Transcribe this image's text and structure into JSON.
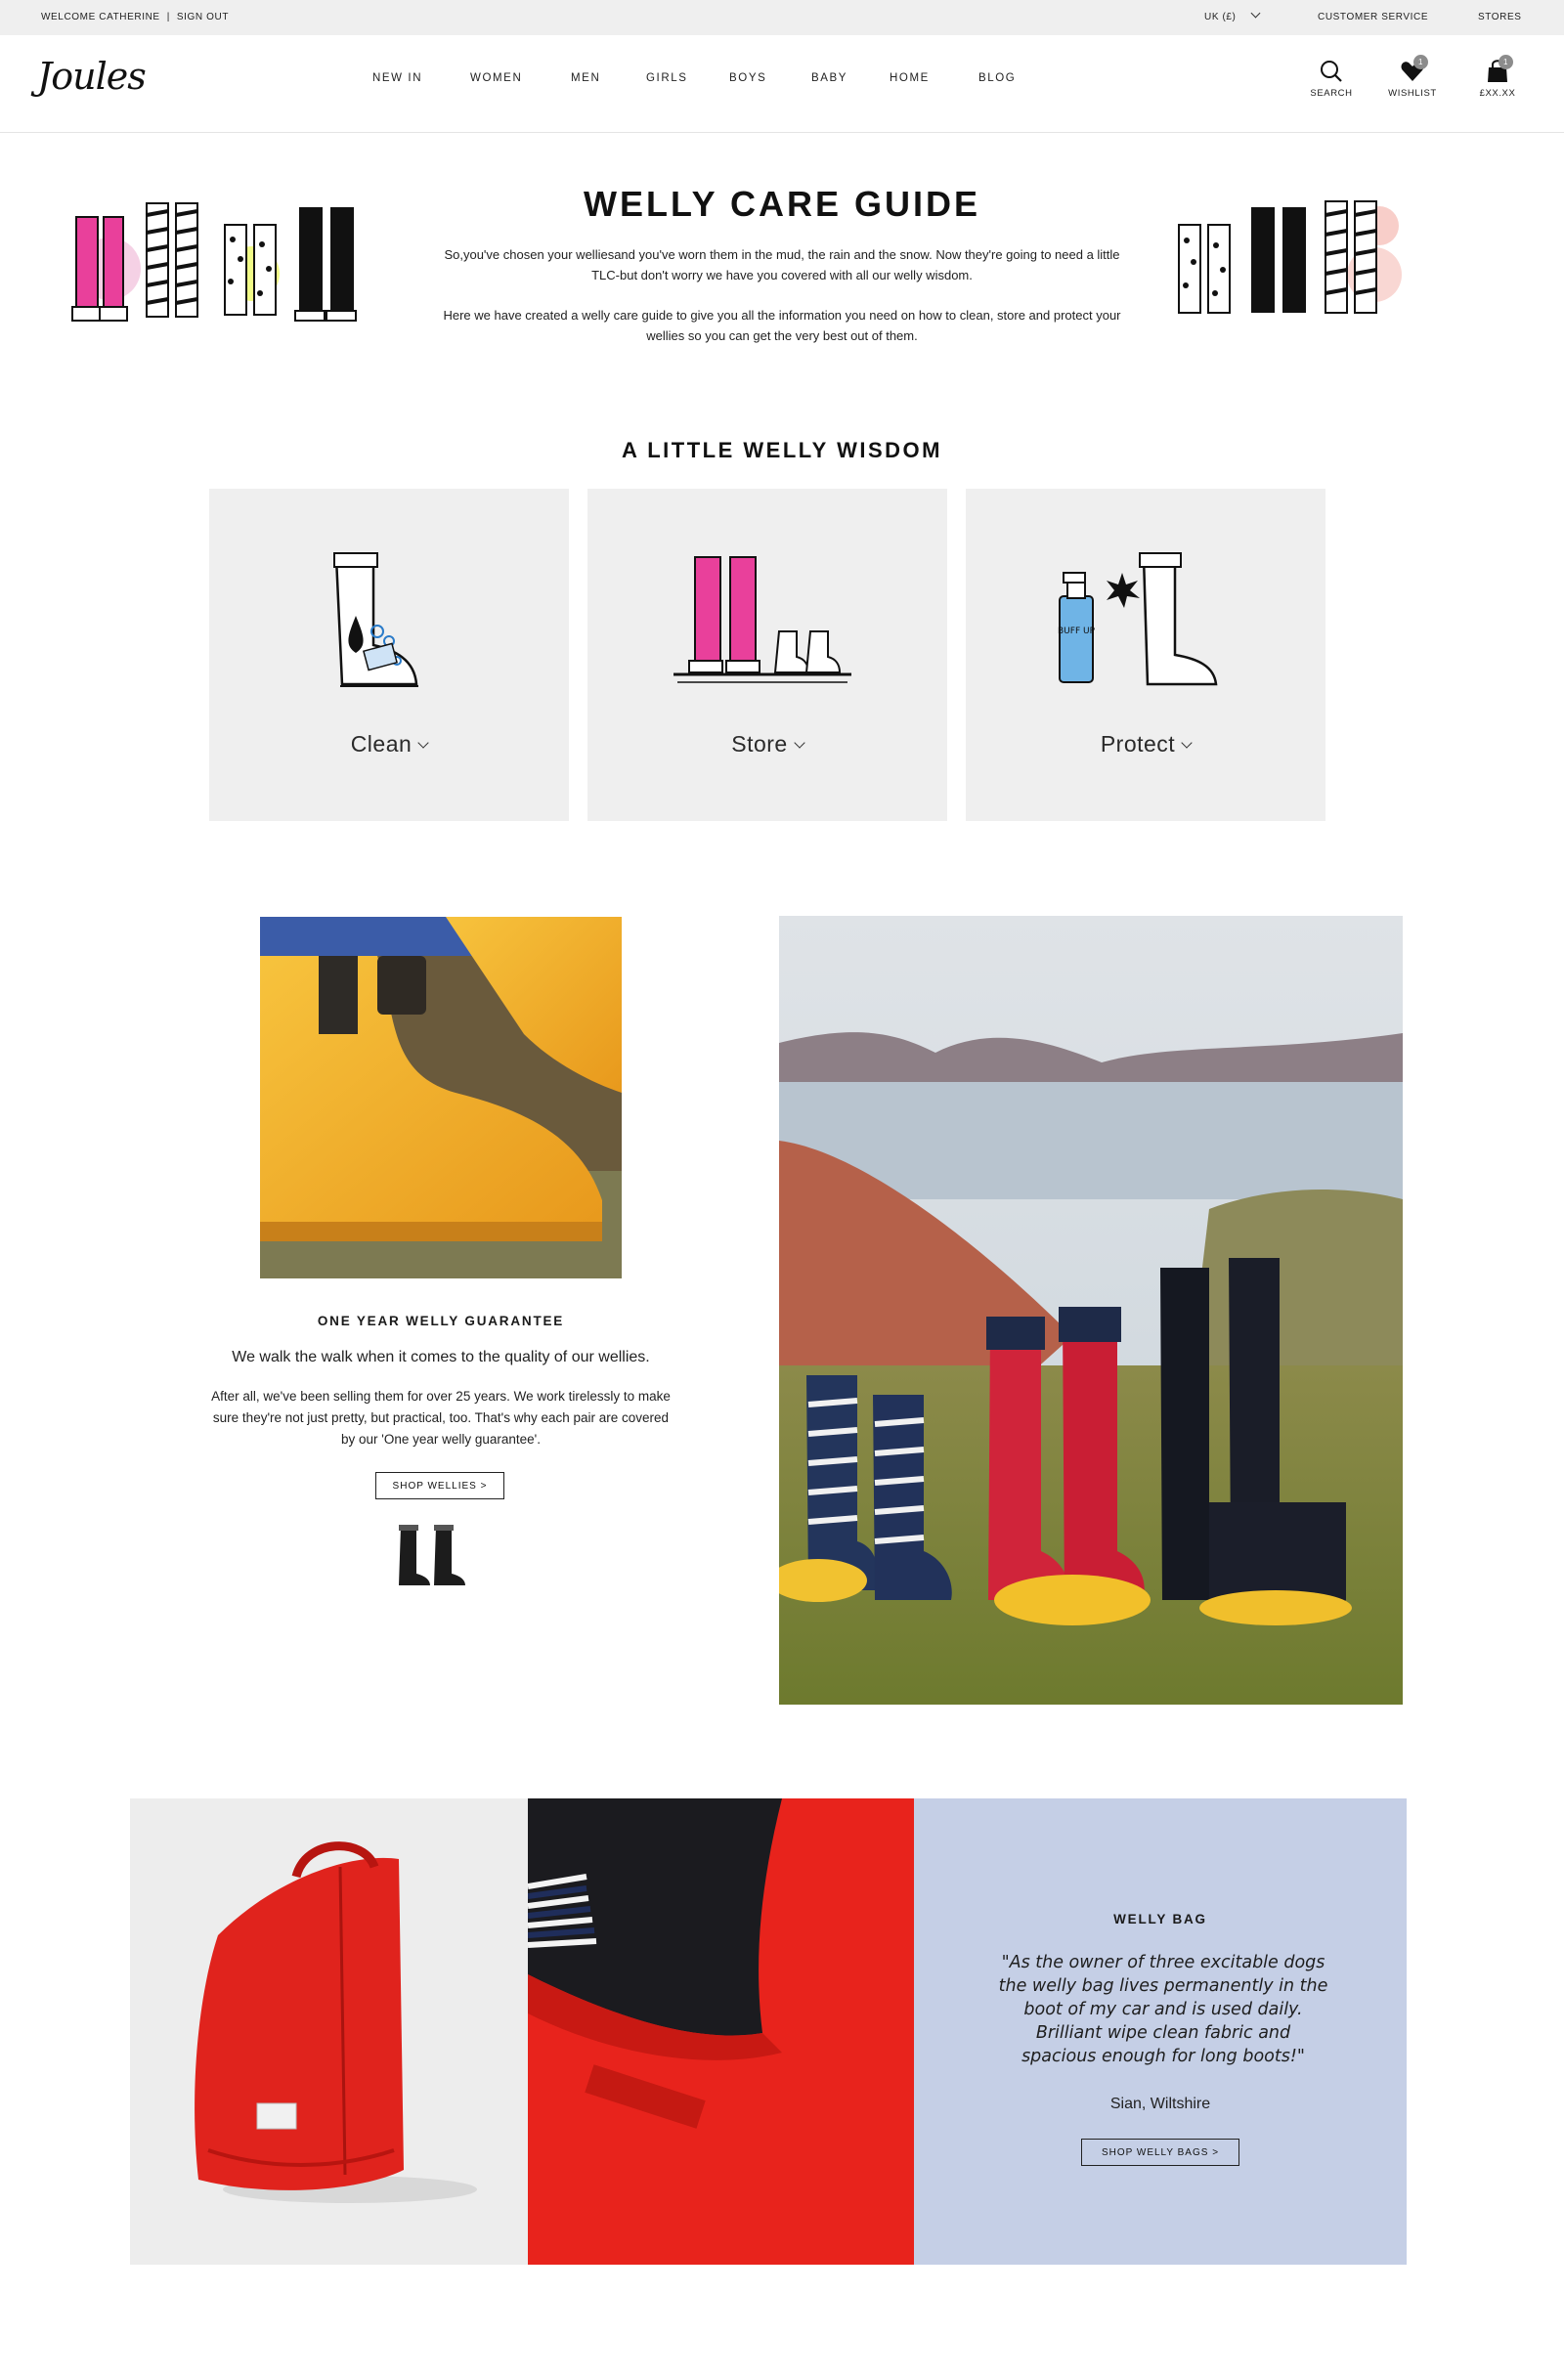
{
  "topbar": {
    "welcome": "WELCOME CATHERINE",
    "divider": "|",
    "sign_out": "SIGN OUT",
    "currency": "UK (£)",
    "customer_service": "CUSTOMER SERVICE",
    "stores": "STORES"
  },
  "header": {
    "logo": "Joules",
    "nav": [
      "NEW IN",
      "WOMEN",
      "MEN",
      "GIRLS",
      "BOYS",
      "BABY",
      "HOME",
      "BLOG"
    ],
    "search_label": "SEARCH",
    "wishlist_label": "WISHLIST",
    "wishlist_count": "1",
    "basket_label": "£XX.XX",
    "basket_count": "1"
  },
  "intro": {
    "title": "WELLY CARE GUIDE",
    "para1": "So,you've chosen your welliesand you've worn them in the mud, the rain and the snow. Now they're going to need a little TLC-but don't worry we have you covered with all our welly wisdom.",
    "para2": "Here we have created a welly care guide to give you all the information you need on how to clean, store and protect your wellies so you can get the very best out of them."
  },
  "wisdom": {
    "title": "A LITTLE WELLY WISDOM",
    "cards": [
      {
        "label": "Clean"
      },
      {
        "label": "Store"
      },
      {
        "label": "Protect"
      }
    ],
    "spray_text": "BUFF UP"
  },
  "guarantee": {
    "title": "ONE YEAR WELLY GUARANTEE",
    "lead": "We walk the walk when it comes to the quality of our wellies.",
    "body": "After all, we've been selling them for over 25 years. We work tirelessly to make sure they're not just pretty, but practical, too. That's why each pair are covered by our 'One year welly guarantee'.",
    "button": "SHOP WELLIES >"
  },
  "welly_bag": {
    "title": "WELLY BAG",
    "quote": "\"As the owner of three excitable dogs the welly bag lives permanently in the boot of my car and is used daily. Brilliant wipe clean fabric and spacious enough for long boots!\"",
    "author": "Sian, Wiltshire",
    "button": "SHOP WELLY BAGS >"
  },
  "colors": {
    "topbar_bg": "#efefef",
    "card_bg": "#efefef",
    "quote_panel_bg": "#c5cfe6",
    "bag_red": "#e0231d",
    "welly_yellow": "#f2ad2b"
  }
}
